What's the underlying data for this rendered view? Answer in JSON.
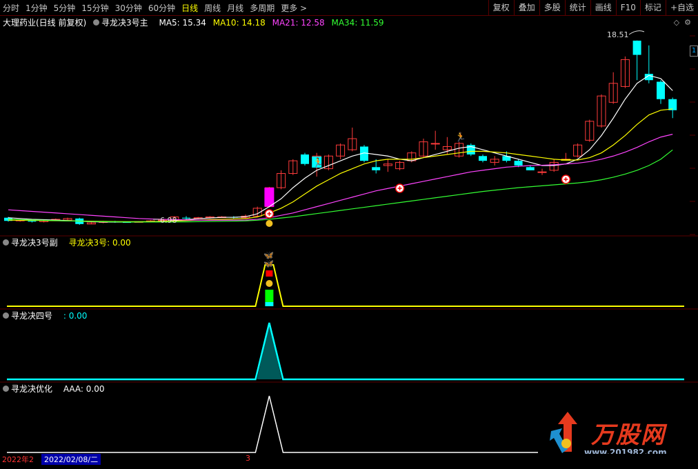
{
  "toolbar": {
    "periods": [
      "分时",
      "1分钟",
      "5分钟",
      "15分钟",
      "30分钟",
      "60分钟",
      "日线",
      "周线",
      "月线",
      "多周期",
      "更多 >"
    ],
    "active_period": "日线",
    "right_buttons": [
      "复权",
      "叠加",
      "多股",
      "统计",
      "画线",
      "F10",
      "标记",
      "+自选"
    ]
  },
  "main": {
    "stock_name": "大理药业(日线 前复权)",
    "indicator": "寻龙决3号主",
    "ma5": "MA5: 15.34",
    "ma10": "MA10: 14.18",
    "ma21": "MA21: 12.58",
    "ma34": "MA34: 11.59",
    "high_label": "18.51",
    "low_label": "6.98",
    "edge_label": "1"
  },
  "panel2": {
    "name": "寻龙决3号副",
    "value": "寻龙决3号: 0.00"
  },
  "panel3": {
    "name": "寻龙决四号",
    "value": ": 0.00"
  },
  "panel4": {
    "name": "寻龙决优化",
    "value": "AAA: 0.00"
  },
  "status": {
    "year": "2022年2",
    "date": "2022/02/08/二",
    "marker": "3"
  },
  "watermark": {
    "brand": "万股网",
    "url": "www.201982.com"
  },
  "colors": {
    "up": "#ff3b3b",
    "down": "#00ffff",
    "ma5": "#ffffff",
    "ma10": "#ffff00",
    "ma21": "#ff44ff",
    "ma34": "#33ff33",
    "grid": "#5a0000"
  },
  "chart_data": {
    "type": "candlestick",
    "price_range": [
      6.5,
      19.5
    ],
    "candles": [
      {
        "o": 7.3,
        "c": 7.1,
        "h": 7.35,
        "l": 7.05
      },
      {
        "o": 7.1,
        "c": 7.15,
        "h": 7.2,
        "l": 7.05
      },
      {
        "o": 7.1,
        "c": 7.05,
        "h": 7.2,
        "l": 7.0
      },
      {
        "o": 7.05,
        "c": 7.15,
        "h": 7.2,
        "l": 7.0
      },
      {
        "o": 7.15,
        "c": 7.2,
        "h": 7.25,
        "l": 7.1
      },
      {
        "o": 7.15,
        "c": 7.25,
        "h": 7.3,
        "l": 7.1
      },
      {
        "o": 7.25,
        "c": 6.9,
        "h": 7.3,
        "l": 6.85
      },
      {
        "o": 6.9,
        "c": 6.98,
        "h": 7.05,
        "l": 6.9
      },
      {
        "o": 7.0,
        "c": 7.05,
        "h": 7.1,
        "l": 6.95
      },
      {
        "o": 7.05,
        "c": 7.02,
        "h": 7.1,
        "l": 6.98
      },
      {
        "o": 7.02,
        "c": 7.0,
        "h": 7.05,
        "l": 6.98
      },
      {
        "o": 7.0,
        "c": 7.05,
        "h": 7.08,
        "l": 6.98
      },
      {
        "o": 7.05,
        "c": 7.1,
        "h": 7.15,
        "l": 7.0
      },
      {
        "o": 7.1,
        "c": 7.15,
        "h": 7.2,
        "l": 7.05
      },
      {
        "o": 7.15,
        "c": 7.35,
        "h": 7.4,
        "l": 7.1
      },
      {
        "o": 7.3,
        "c": 7.25,
        "h": 7.4,
        "l": 7.2
      },
      {
        "o": 7.25,
        "c": 7.3,
        "h": 7.35,
        "l": 7.2
      },
      {
        "o": 7.3,
        "c": 7.35,
        "h": 7.4,
        "l": 7.25
      },
      {
        "o": 7.35,
        "c": 7.35,
        "h": 7.4,
        "l": 7.3
      },
      {
        "o": 7.35,
        "c": 7.3,
        "h": 7.4,
        "l": 7.25
      },
      {
        "o": 7.3,
        "c": 7.4,
        "h": 7.5,
        "l": 7.25
      },
      {
        "o": 7.4,
        "c": 7.9,
        "h": 8.0,
        "l": 7.35
      },
      {
        "o": 8.0,
        "c": 9.2,
        "h": 9.25,
        "l": 7.95
      },
      {
        "o": 9.2,
        "c": 10.1,
        "h": 10.3,
        "l": 9.1
      },
      {
        "o": 10.1,
        "c": 10.9,
        "h": 11.0,
        "l": 10.0
      },
      {
        "o": 11.3,
        "c": 10.7,
        "h": 11.4,
        "l": 10.6
      },
      {
        "o": 10.6,
        "c": 11.2,
        "h": 11.4,
        "l": 9.9
      },
      {
        "o": 10.4,
        "c": 11.2,
        "h": 11.3,
        "l": 10.3
      },
      {
        "o": 11.2,
        "c": 11.9,
        "h": 12.0,
        "l": 11.0
      },
      {
        "o": 11.6,
        "c": 12.3,
        "h": 13.0,
        "l": 11.5
      },
      {
        "o": 11.8,
        "c": 10.9,
        "h": 11.9,
        "l": 10.8
      },
      {
        "o": 10.5,
        "c": 10.3,
        "h": 11.0,
        "l": 10.1
      },
      {
        "o": 10.6,
        "c": 10.7,
        "h": 11.0,
        "l": 10.2
      },
      {
        "o": 10.4,
        "c": 10.8,
        "h": 10.9,
        "l": 10.3
      },
      {
        "o": 10.9,
        "c": 11.4,
        "h": 11.5,
        "l": 10.8
      },
      {
        "o": 11.2,
        "c": 12.1,
        "h": 12.3,
        "l": 11.1
      },
      {
        "o": 12.0,
        "c": 12.0,
        "h": 12.8,
        "l": 11.6
      },
      {
        "o": 11.6,
        "c": 11.8,
        "h": 12.4,
        "l": 11.3
      },
      {
        "o": 11.2,
        "c": 12.0,
        "h": 12.1,
        "l": 11.1
      },
      {
        "o": 11.9,
        "c": 11.3,
        "h": 12.0,
        "l": 11.2
      },
      {
        "o": 11.2,
        "c": 10.9,
        "h": 11.3,
        "l": 10.8
      },
      {
        "o": 10.8,
        "c": 11.0,
        "h": 11.2,
        "l": 10.6
      },
      {
        "o": 11.2,
        "c": 10.9,
        "h": 11.5,
        "l": 10.8
      },
      {
        "o": 10.9,
        "c": 10.6,
        "h": 11.0,
        "l": 10.5
      },
      {
        "o": 10.5,
        "c": 10.3,
        "h": 10.6,
        "l": 10.3
      },
      {
        "o": 10.2,
        "c": 10.2,
        "h": 10.4,
        "l": 10.0
      },
      {
        "o": 10.3,
        "c": 10.8,
        "h": 11.0,
        "l": 10.2
      },
      {
        "o": 11.0,
        "c": 11.0,
        "h": 11.4,
        "l": 11.0
      },
      {
        "o": 11.2,
        "c": 11.9,
        "h": 12.0,
        "l": 11.1
      },
      {
        "o": 12.2,
        "c": 13.4,
        "h": 13.5,
        "l": 12.1
      },
      {
        "o": 13.1,
        "c": 15.0,
        "h": 15.1,
        "l": 13.0
      },
      {
        "o": 14.6,
        "c": 15.8,
        "h": 16.5,
        "l": 14.5
      },
      {
        "o": 15.6,
        "c": 17.3,
        "h": 17.5,
        "l": 15.5
      },
      {
        "o": 18.5,
        "c": 17.6,
        "h": 18.51,
        "l": 16.0
      },
      {
        "o": 16.4,
        "c": 16.0,
        "h": 18.2,
        "l": 15.8
      },
      {
        "o": 15.9,
        "c": 14.8,
        "h": 16.0,
        "l": 14.5
      },
      {
        "o": 14.8,
        "c": 14.1,
        "h": 14.9,
        "l": 13.6
      }
    ],
    "ma5": [
      7.3,
      7.25,
      7.2,
      7.18,
      7.15,
      7.12,
      7.08,
      7.05,
      7.03,
      7.02,
      7.02,
      7.03,
      7.05,
      7.08,
      7.12,
      7.18,
      7.24,
      7.28,
      7.32,
      7.33,
      7.36,
      7.55,
      8.0,
      8.5,
      9.2,
      9.8,
      10.3,
      10.6,
      10.9,
      11.2,
      11.4,
      11.3,
      11.2,
      11.0,
      10.9,
      11.1,
      11.3,
      11.5,
      11.7,
      11.8,
      11.6,
      11.4,
      11.2,
      11.0,
      10.8,
      10.6,
      10.6,
      10.7,
      11.0,
      11.6,
      12.5,
      13.6,
      14.8,
      15.8,
      16.3,
      16.1,
      15.34
    ],
    "ma10": [
      7.15,
      7.14,
      7.13,
      7.12,
      7.11,
      7.1,
      7.09,
      7.08,
      7.07,
      7.06,
      7.05,
      7.05,
      7.06,
      7.07,
      7.09,
      7.12,
      7.15,
      7.18,
      7.2,
      7.22,
      7.24,
      7.35,
      7.6,
      7.9,
      8.3,
      8.8,
      9.3,
      9.7,
      10.1,
      10.4,
      10.7,
      10.9,
      11.0,
      11.0,
      11.0,
      11.1,
      11.2,
      11.3,
      11.4,
      11.5,
      11.5,
      11.45,
      11.4,
      11.3,
      11.2,
      11.1,
      11.0,
      10.95,
      10.95,
      11.1,
      11.4,
      11.9,
      12.5,
      13.2,
      13.8,
      14.1,
      14.18
    ],
    "ma21": [
      7.8,
      7.75,
      7.7,
      7.65,
      7.6,
      7.55,
      7.5,
      7.45,
      7.4,
      7.35,
      7.3,
      7.25,
      7.22,
      7.2,
      7.18,
      7.16,
      7.15,
      7.14,
      7.14,
      7.14,
      7.15,
      7.2,
      7.3,
      7.45,
      7.6,
      7.8,
      8.0,
      8.2,
      8.4,
      8.6,
      8.8,
      9.0,
      9.15,
      9.3,
      9.45,
      9.6,
      9.75,
      9.9,
      10.05,
      10.2,
      10.3,
      10.4,
      10.5,
      10.55,
      10.6,
      10.62,
      10.65,
      10.7,
      10.75,
      10.85,
      11.0,
      11.2,
      11.45,
      11.75,
      12.1,
      12.4,
      12.58
    ],
    "ma34": [
      7.2,
      7.18,
      7.16,
      7.14,
      7.12,
      7.1,
      7.08,
      7.06,
      7.05,
      7.04,
      7.03,
      7.03,
      7.03,
      7.03,
      7.03,
      7.04,
      7.05,
      7.06,
      7.07,
      7.08,
      7.1,
      7.14,
      7.2,
      7.28,
      7.36,
      7.46,
      7.56,
      7.66,
      7.76,
      7.86,
      7.96,
      8.06,
      8.16,
      8.26,
      8.36,
      8.46,
      8.56,
      8.66,
      8.76,
      8.86,
      8.96,
      9.04,
      9.12,
      9.2,
      9.26,
      9.32,
      9.38,
      9.44,
      9.5,
      9.58,
      9.7,
      9.86,
      10.06,
      10.3,
      10.6,
      11.0,
      11.59
    ]
  }
}
